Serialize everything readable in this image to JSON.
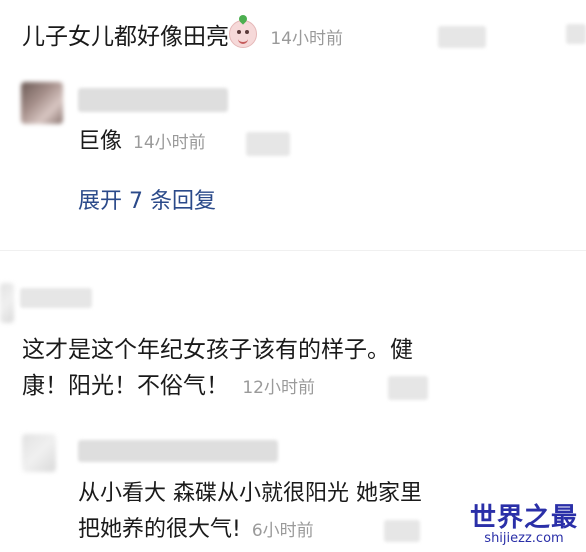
{
  "comments": {
    "c1": {
      "text": "儿子女儿都好像田亮",
      "emoji": "crying-face-emoji",
      "time": "14小时前"
    },
    "c1_reply": {
      "text": "巨像",
      "time": "14小时前"
    },
    "expand_label": "展开 7 条回复",
    "c2": {
      "text_line1": "这才是这个年纪女孩子该有的样子。健",
      "text_line2": "康！阳光！不俗气！",
      "time": "12小时前"
    },
    "c2_reply": {
      "text_line1": "从小看大 森碟从小就很阳光 她家里",
      "text_line2": "把她养的很大气!",
      "time": "6小时前"
    }
  },
  "watermark": {
    "main": "世界之最",
    "sub": "shijiezz.com"
  },
  "colors": {
    "time": "#9a9a9a",
    "link": "#2b4a8a",
    "watermark": "#2a2fa8"
  }
}
